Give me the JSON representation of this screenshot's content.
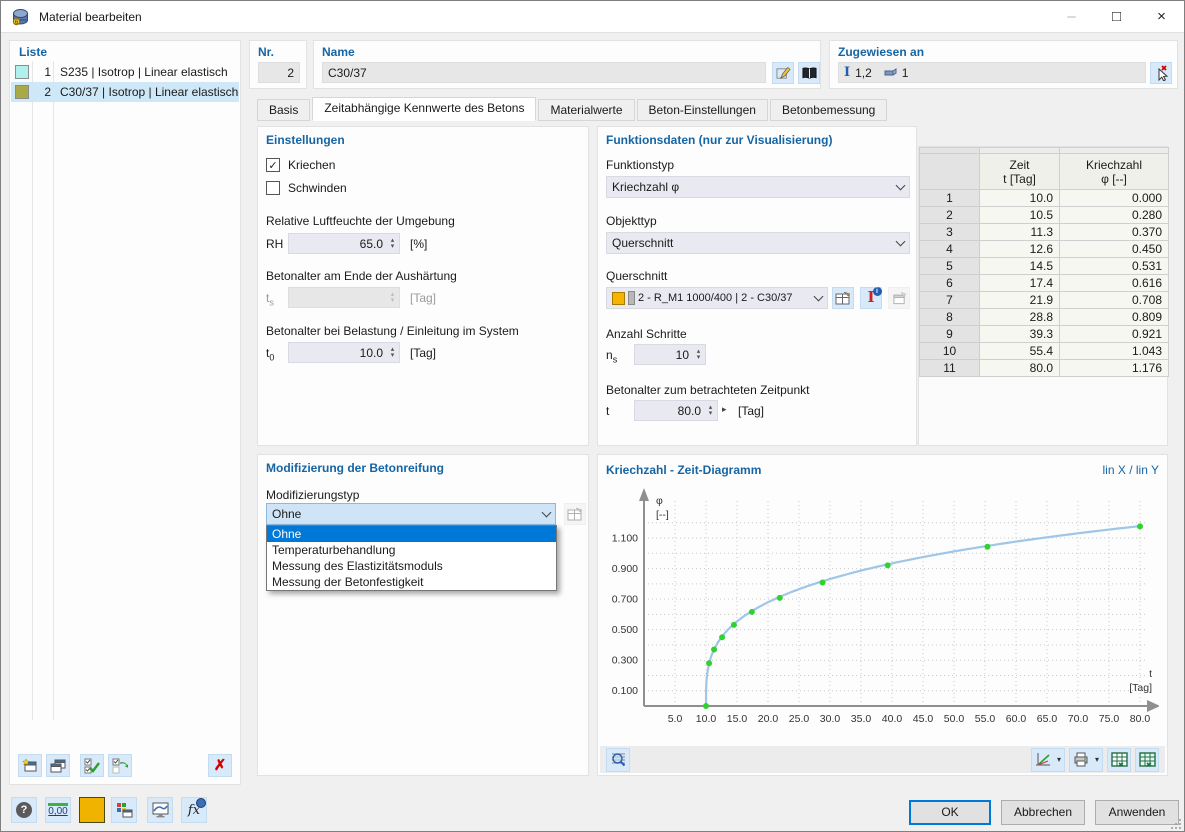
{
  "window": {
    "title": "Material bearbeiten",
    "minimize": "–",
    "maximize": "□",
    "close": "×"
  },
  "liste": {
    "label": "Liste",
    "items": [
      {
        "num": "1",
        "label": "S235 | Isotrop | Linear elastisch",
        "swatch": "#b0f0ee",
        "selected": false
      },
      {
        "num": "2",
        "label": "C30/37 | Isotrop | Linear elastisch",
        "swatch": "#a9aa47",
        "selected": true
      }
    ]
  },
  "header_fields": {
    "nr_label": "Nr.",
    "nr_value": "2",
    "name_label": "Name",
    "name_value": "C30/37",
    "assigned_label": "Zugewiesen an",
    "assigned_members": "1,2",
    "assigned_solids": "1"
  },
  "tabs": {
    "labels": [
      "Basis",
      "Zeitabhängige Kennwerte des Betons",
      "Materialwerte",
      "Beton-Einstellungen",
      "Betonbemessung"
    ],
    "active_index": 1
  },
  "einstellungen": {
    "title": "Einstellungen",
    "kriechen_label": "Kriechen",
    "kriechen_checked": true,
    "schwinden_label": "Schwinden",
    "schwinden_checked": false,
    "rh_label": "Relative Luftfeuchte der Umgebung",
    "rh_symbol": "RH",
    "rh_value": "65.0",
    "rh_unit": "[%]",
    "ts_label": "Betonalter am Ende der Aushärtung",
    "ts_symbol_base": "t",
    "ts_symbol_sub": "s",
    "ts_value": "",
    "ts_unit": "[Tag]",
    "t0_label": "Betonalter bei Belastung / Einleitung im System",
    "t0_symbol_base": "t",
    "t0_symbol_sub": "0",
    "t0_value": "10.0",
    "t0_unit": "[Tag]"
  },
  "modifizierung": {
    "title": "Modifizierung der Betonreifung",
    "typ_label": "Modifizierungstyp",
    "selected": "Ohne",
    "selected_index": 0,
    "options": [
      "Ohne",
      "Temperaturbehandlung",
      "Messung des Elastizitätsmoduls",
      "Messung der Betonfestigkeit"
    ]
  },
  "funktionsdaten": {
    "title": "Funktionsdaten (nur zur Visualisierung)",
    "funktionstyp_label": "Funktionstyp",
    "funktionstyp_value": "Kriechzahl φ",
    "objekttyp_label": "Objekttyp",
    "objekttyp_value": "Querschnitt",
    "querschnitt_label": "Querschnitt",
    "querschnitt_value": "2 - R_M1 1000/400 | 2 - C30/37",
    "anzahl_label": "Anzahl Schritte",
    "anzahl_symbol_base": "n",
    "anzahl_symbol_sub": "s",
    "anzahl_value": "10",
    "betonalter_label": "Betonalter zum betrachteten Zeitpunkt",
    "betonalter_symbol": "t",
    "betonalter_value": "80.0",
    "betonalter_unit": "[Tag]"
  },
  "table": {
    "headers": {
      "zeit_title": "Zeit",
      "zeit_sub": "t [Tag]",
      "kriechzahl_title": "Kriechzahl",
      "kriechzahl_sub": "φ [--]"
    },
    "rows": [
      [
        "1",
        "10.0",
        "0.000"
      ],
      [
        "2",
        "10.5",
        "0.280"
      ],
      [
        "3",
        "11.3",
        "0.370"
      ],
      [
        "4",
        "12.6",
        "0.450"
      ],
      [
        "5",
        "14.5",
        "0.531"
      ],
      [
        "6",
        "17.4",
        "0.616"
      ],
      [
        "7",
        "21.9",
        "0.708"
      ],
      [
        "8",
        "28.8",
        "0.809"
      ],
      [
        "9",
        "39.3",
        "0.921"
      ],
      [
        "10",
        "55.4",
        "1.043"
      ],
      [
        "11",
        "80.0",
        "1.176"
      ]
    ]
  },
  "chart": {
    "title": "Kriechzahl - Zeit-Diagramm",
    "scale_note": "lin X / lin Y"
  },
  "chart_data": {
    "type": "line",
    "title": "Kriechzahl - Zeit-Diagramm",
    "xlabel": "t",
    "xunit": "[Tag]",
    "ylabel": "φ",
    "yunit": "[--]",
    "x": [
      10.0,
      10.5,
      11.3,
      12.6,
      14.5,
      17.4,
      21.9,
      28.8,
      39.3,
      55.4,
      80.0
    ],
    "y": [
      0.0,
      0.28,
      0.37,
      0.45,
      0.531,
      0.616,
      0.708,
      0.809,
      0.921,
      1.043,
      1.176
    ],
    "xticks": [
      5,
      10,
      15,
      20,
      25,
      30,
      35,
      40,
      45,
      50,
      55,
      60,
      65,
      70,
      75,
      80
    ],
    "ytick_labels": [
      0.1,
      0.3,
      0.5,
      0.7,
      0.9,
      1.1
    ],
    "ygrid_step": 0.1,
    "xlim": [
      0,
      84
    ],
    "ylim": [
      0,
      1.25
    ],
    "grid": true,
    "legend": false,
    "scale_note": "lin X / lin Y",
    "line_color": "#9fc6e7",
    "point_color": "#2fd22f",
    "axis_color": "#8f8f8f"
  },
  "footer": {
    "ok": "OK",
    "cancel": "Abbrechen",
    "apply": "Anwenden"
  },
  "icons": {
    "check": "✓",
    "spin_up": "▴",
    "spin_down": "▾",
    "play": "▸",
    "dropdown_arrow": "▾",
    "help": "?",
    "decimal": "0,00",
    "fx": "fx",
    "delete": "✗"
  },
  "colors": {
    "accent": "#1565a5",
    "highlight": "#0078d7",
    "list_selected": "#cfe8f8",
    "field": "#e9e9f1",
    "readonly": "#e7e7e7",
    "button_blue": "#d8e9f9",
    "querschnitt_swatch": "#f6b300",
    "steel_swatch": "#b0f0ee",
    "concrete_swatch": "#a9aa47",
    "delete_red": "#d40000"
  }
}
